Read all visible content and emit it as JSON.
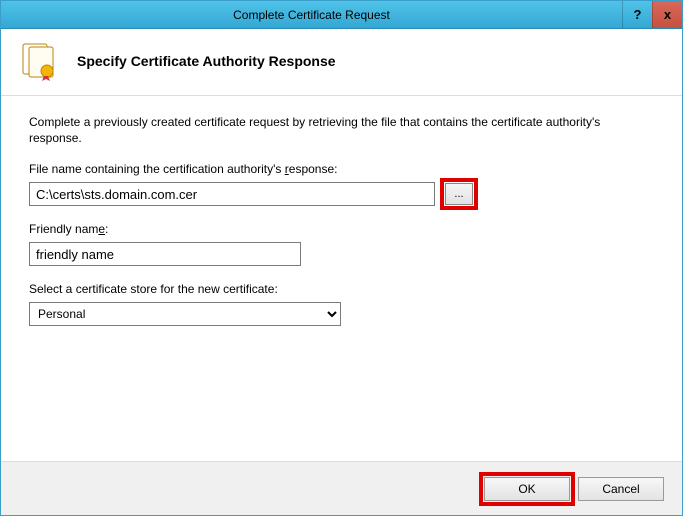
{
  "window": {
    "title": "Complete Certificate Request",
    "help": "?",
    "close": "x"
  },
  "header": {
    "heading": "Specify Certificate Authority Response"
  },
  "content": {
    "description": "Complete a previously created certificate request by retrieving the file that contains the certificate authority's response.",
    "file_label_pre": "File name containing the certification authority's ",
    "file_label_uchar": "r",
    "file_label_post": "esponse:",
    "file_value": "C:\\certs\\sts.domain.com.cer",
    "browse_label": "...",
    "friendly_label_pre": "Friendly nam",
    "friendly_label_uchar": "e",
    "friendly_label_post": ":",
    "friendly_value": "friendly name",
    "store_label": "Select a certificate store for the new certificate:",
    "store_value": "Personal"
  },
  "footer": {
    "ok": "OK",
    "cancel": "Cancel"
  }
}
